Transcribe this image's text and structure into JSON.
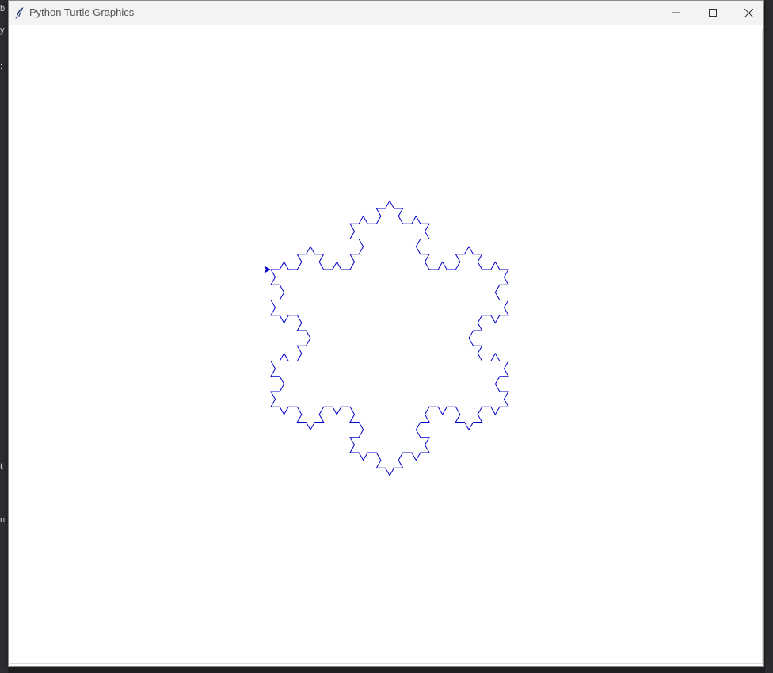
{
  "window": {
    "title": "Python Turtle Graphics",
    "icon": "feather-icon",
    "controls": [
      {
        "name": "minimize-button",
        "icon": "minimize-icon"
      },
      {
        "name": "maximize-button",
        "icon": "maximize-icon"
      },
      {
        "name": "close-button",
        "icon": "close-icon"
      }
    ]
  },
  "turtle": {
    "pen_color": "#0000cc",
    "shape": "arrow",
    "figure": "koch-snowflake",
    "order": 3
  },
  "colors": {
    "titlebar": "#f3f3f3",
    "canvas": "#ffffff",
    "pen": "#0000cc"
  }
}
